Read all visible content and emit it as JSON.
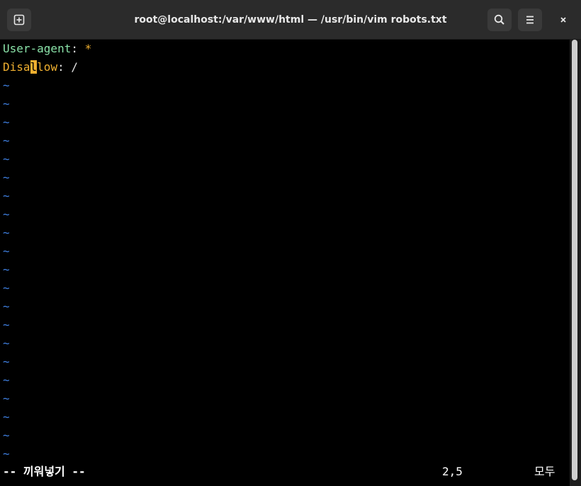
{
  "window": {
    "title": "root@localhost:/var/www/html — /usr/bin/vim robots.txt"
  },
  "icons": {
    "new_tab": "new-tab-icon",
    "search": "search-icon",
    "menu": "hamburger-menu-icon",
    "close": "close-icon"
  },
  "editor": {
    "line1": {
      "key": "User-agent",
      "sep": ": ",
      "value": "*"
    },
    "line2": {
      "key_before_cursor": "Disa",
      "cursor_char": "l",
      "key_after_cursor": "low",
      "sep": ": ",
      "value": "/"
    },
    "tilde": "~"
  },
  "status": {
    "mode": "-- 끼워넣기 --",
    "position": "2,5",
    "scroll": "모두"
  },
  "colors": {
    "keyword": "#8ae2a8",
    "directive": "#f0b030",
    "cursor": "#f0b030",
    "tilde": "#3f7fe0",
    "background": "#000000"
  }
}
